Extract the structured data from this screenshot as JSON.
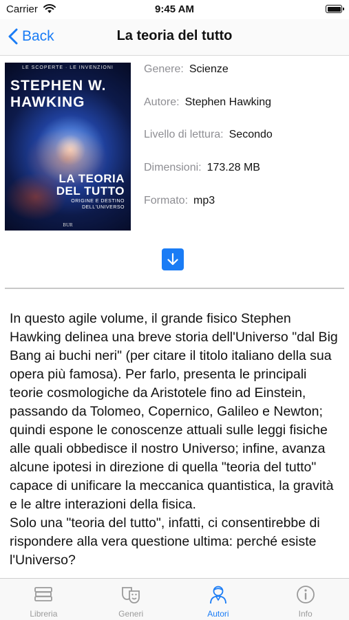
{
  "status_bar": {
    "carrier": "Carrier",
    "time": "9:45 AM"
  },
  "nav": {
    "back_label": "Back",
    "title": "La teoria del tutto"
  },
  "cover": {
    "collection": "LE SCOPERTE · LE INVENZIONI",
    "author_line1": "STEPHEN W.",
    "author_line2": "HAWKING",
    "title_line1": "LA TEORIA",
    "title_line2": "DEL TUTTO",
    "subtitle_line1": "ORIGINE E DESTINO",
    "subtitle_line2": "DELL'UNIVERSO",
    "publisher": "BUR"
  },
  "details": [
    {
      "label": "Genere:",
      "value": "Scienze"
    },
    {
      "label": "Autore:",
      "value": "Stephen Hawking"
    },
    {
      "label": "Livello di lettura:",
      "value": "Secondo"
    },
    {
      "label": "Dimensioni:",
      "value": "173.28 MB"
    },
    {
      "label": "Formato:",
      "value": "mp3"
    }
  ],
  "download_icon": "arrow-down-icon",
  "description": "In questo agile volume, il grande fisico Stephen Hawking delinea una breve storia dell'Universo \"dal Big Bang ai buchi neri\" (per citare il titolo italiano della sua opera più famosa). Per farlo, presenta le principali teorie cosmologiche da Aristotele fino ad Einstein, passando da Tolomeo, Copernico, Galileo e Newton; quindi espone le conoscenze attuali sulle leggi fisiche alle quali obbedisce il nostro Universo; infine, avanza alcune ipotesi in direzione di quella \"teoria del tutto\" capace di unificare la meccanica quantistica, la gravità e le altre interazioni della fisica.\nSolo una \"teoria del tutto\", infatti, ci consentirebbe di rispondere alla vera questione ultima: perché esiste l'Universo?",
  "tabs": [
    {
      "label": "Libreria",
      "icon": "books-stack-icon",
      "active": false
    },
    {
      "label": "Generi",
      "icon": "theater-masks-icon",
      "active": false
    },
    {
      "label": "Autori",
      "icon": "person-icon",
      "active": true
    },
    {
      "label": "Info",
      "icon": "info-icon",
      "active": false
    }
  ],
  "colors": {
    "accent": "#1a7cf5",
    "label_gray": "#8e8e93",
    "tab_inactive": "#9a9a9a"
  }
}
